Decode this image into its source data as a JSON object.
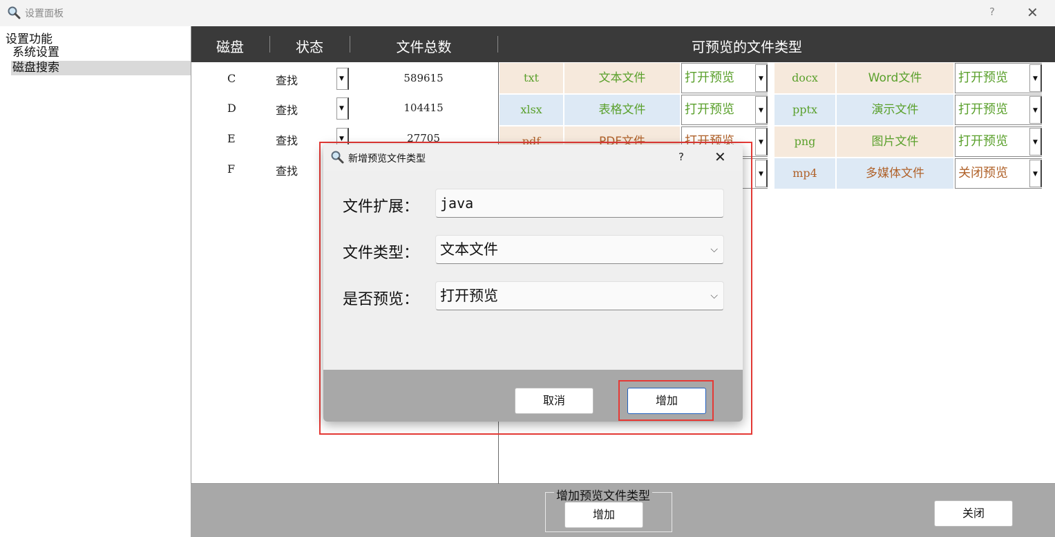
{
  "window": {
    "title": "设置面板",
    "help": "?",
    "close": "✕"
  },
  "sidebar": {
    "root": "设置功能",
    "items": [
      {
        "label": "系统设置"
      },
      {
        "label": "磁盘搜索",
        "selected": true
      }
    ]
  },
  "table_header": {
    "disk": "磁盘",
    "status": "状态",
    "total": "文件总数",
    "previewable": "可预览的文件类型"
  },
  "disks": [
    {
      "letter": "C",
      "status": "查找",
      "count": "589615"
    },
    {
      "letter": "D",
      "status": "查找",
      "count": "104415"
    },
    {
      "letter": "E",
      "status": "查找",
      "count": "27705"
    },
    {
      "letter": "F",
      "status": "查找",
      "count": ""
    }
  ],
  "file_types": [
    {
      "ext": "txt",
      "type": "文本文件",
      "preview": "打开预览"
    },
    {
      "ext": "docx",
      "type": "Word文件",
      "preview": "打开预览"
    },
    {
      "ext": "xlsx",
      "type": "表格文件",
      "preview": "打开预览"
    },
    {
      "ext": "pptx",
      "type": "演示文件",
      "preview": "打开预览"
    },
    {
      "ext": "pdf",
      "type": "PDF文件",
      "preview": "打开预览"
    },
    {
      "ext": "png",
      "type": "图片文件",
      "preview": "打开预览"
    },
    {
      "ext": "",
      "type": "",
      "preview": ""
    },
    {
      "ext": "mp4",
      "type": "多媒体文件",
      "preview": "关闭预览"
    }
  ],
  "colors": {
    "peach": "#f6e9dc",
    "blue": "#dde9f5",
    "green_text": "#5aa02c",
    "orange_text": "#b0622a",
    "highlight": "#e53935",
    "header": "#3a3a3a"
  },
  "bottom": {
    "group_label": "增加预览文件类型",
    "add_button": "增加",
    "close_button": "关闭"
  },
  "dialog": {
    "title": "新增预览文件类型",
    "help": "?",
    "close": "✕",
    "ext_label": "文件扩展：",
    "ext_value": "java",
    "type_label": "文件类型：",
    "type_value": "文本文件",
    "preview_label": "是否预览：",
    "preview_value": "打开预览",
    "cancel": "取消",
    "add": "增加"
  }
}
